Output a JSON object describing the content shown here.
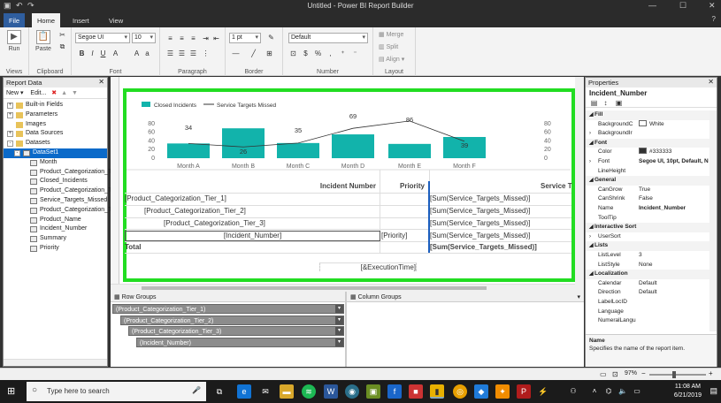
{
  "window": {
    "title": "Untitled - Power BI Report Builder"
  },
  "tabs": [
    "File",
    "Home",
    "Insert",
    "View"
  ],
  "ribbon": {
    "run": "Run",
    "paste": "Paste",
    "groups": [
      "Views",
      "Clipboard",
      "Font",
      "Paragraph",
      "Border",
      "Number",
      "Layout"
    ],
    "font_name": "Segoe UI",
    "font_size": "10",
    "border_size": "1 pt",
    "number_format": "Default",
    "merge": "Merge",
    "split": "Split",
    "align": "Align"
  },
  "report_data": {
    "title": "Report Data",
    "new": "New",
    "edit": "Edit...",
    "items": [
      {
        "label": "Built-in Fields",
        "level": 0,
        "type": "folder",
        "exp": "+"
      },
      {
        "label": "Parameters",
        "level": 0,
        "type": "folder",
        "exp": "+"
      },
      {
        "label": "Images",
        "level": 0,
        "type": "folder",
        "exp": ""
      },
      {
        "label": "Data Sources",
        "level": 0,
        "type": "folder",
        "exp": "+"
      },
      {
        "label": "Datasets",
        "level": 0,
        "type": "folder",
        "exp": "-"
      },
      {
        "label": "DataSet1",
        "level": 1,
        "type": "dataset",
        "exp": "-",
        "selected": true
      },
      {
        "label": "Month",
        "level": 2,
        "type": "field",
        "exp": ""
      },
      {
        "label": "Product_Categorization_Tier_1",
        "level": 2,
        "type": "field",
        "exp": ""
      },
      {
        "label": "Closed_Incidents",
        "level": 2,
        "type": "field",
        "exp": ""
      },
      {
        "label": "Product_Categorization_Tier_2",
        "level": 2,
        "type": "field",
        "exp": ""
      },
      {
        "label": "Service_Targets_Missed",
        "level": 2,
        "type": "field",
        "exp": ""
      },
      {
        "label": "Product_Categorization_Tier_3",
        "level": 2,
        "type": "field",
        "exp": ""
      },
      {
        "label": "Product_Name",
        "level": 2,
        "type": "field",
        "exp": ""
      },
      {
        "label": "Incident_Number",
        "level": 2,
        "type": "field",
        "exp": ""
      },
      {
        "label": "Summary",
        "level": 2,
        "type": "field",
        "exp": ""
      },
      {
        "label": "Priority",
        "level": 2,
        "type": "field",
        "exp": ""
      }
    ]
  },
  "chart_data": {
    "type": "bar",
    "categories": [
      "Month A",
      "Month B",
      "Month C",
      "Month D",
      "Month E",
      "Month F"
    ],
    "series": [
      {
        "name": "Closed Incidents",
        "type": "bar",
        "values": [
          34,
          69,
          35,
          55,
          33,
          49
        ],
        "color": "#12b3ab"
      },
      {
        "name": "Service Targets Missed",
        "type": "line",
        "values": [
          34,
          26,
          35,
          69,
          86,
          39
        ],
        "color": "#333333"
      }
    ],
    "data_labels": [
      "34",
      "26",
      "35",
      "69",
      "86",
      "39"
    ],
    "yticks": [
      0,
      20,
      40,
      60,
      80
    ],
    "ylim": [
      0,
      100
    ],
    "legend": "top-left"
  },
  "tablix": {
    "headers": {
      "incident": "Incident Number",
      "priority": "Priority",
      "service": "Service T"
    },
    "rows": [
      {
        "group": "[Product_Categorization_Tier_1]",
        "sum": "[Sum(Service_Targets_Missed)]"
      },
      {
        "group": "[Product_Categorization_Tier_2]",
        "sum": "[Sum(Service_Targets_Missed)]"
      },
      {
        "group": "[Product_Categorization_Tier_3]",
        "sum": "[Sum(Service_Targets_Missed)]"
      }
    ],
    "detail": {
      "incident": "[Incident_Number]",
      "priority": "[Priority]",
      "sum": "[Sum(Service_Targets_Missed)]"
    },
    "total": {
      "label": "Total",
      "sum": "[Sum(Service_Targets_Missed)]"
    },
    "footer": "[&ExecutionTime]"
  },
  "row_groups": {
    "title": "Row Groups",
    "items": [
      "(Product_Categorization_Tier_1)",
      "(Product_Categorization_Tier_2)",
      "(Product_Categorization_Tier_3)",
      "(Incident_Number)"
    ]
  },
  "column_groups": {
    "title": "Column Groups"
  },
  "properties": {
    "title": "Properties",
    "object": "Incident_Number",
    "rows": [
      {
        "cat": true,
        "k": "Fill"
      },
      {
        "k": "BackgroundC",
        "v": "White",
        "swatch": "#ffffff"
      },
      {
        "k": "BackgroundIr",
        "v": "",
        "arr": "›"
      },
      {
        "cat": true,
        "k": "Font"
      },
      {
        "k": "Color",
        "v": "#333333",
        "swatch": "#333333"
      },
      {
        "k": "Font",
        "v": "Segoe UI, 10pt, Default, N",
        "arr": "›"
      },
      {
        "k": "LineHeight",
        "v": ""
      },
      {
        "cat": true,
        "k": "General"
      },
      {
        "k": "CanGrow",
        "v": "True"
      },
      {
        "k": "CanShrink",
        "v": "False"
      },
      {
        "k": "Name",
        "v": "Incident_Number"
      },
      {
        "k": "ToolTip",
        "v": ""
      },
      {
        "cat": true,
        "k": "Interactive Sort"
      },
      {
        "k": "UserSort",
        "v": "",
        "arr": "›"
      },
      {
        "cat": true,
        "k": "Lists"
      },
      {
        "k": "ListLevel",
        "v": "3"
      },
      {
        "k": "ListStyle",
        "v": "None"
      },
      {
        "cat": true,
        "k": "Localization"
      },
      {
        "k": "Calendar",
        "v": "Default"
      },
      {
        "k": "Direction",
        "v": "Default"
      },
      {
        "k": "LabelLocID",
        "v": ""
      },
      {
        "k": "Language",
        "v": ""
      },
      {
        "k": "NumeralLangu",
        "v": ""
      }
    ],
    "desc_title": "Name",
    "desc_text": "Specifies the name of the report item."
  },
  "status": {
    "zoom": "97%"
  },
  "taskbar": {
    "search": "Type here to search",
    "time": "11:08 AM",
    "date": "6/21/2019"
  }
}
